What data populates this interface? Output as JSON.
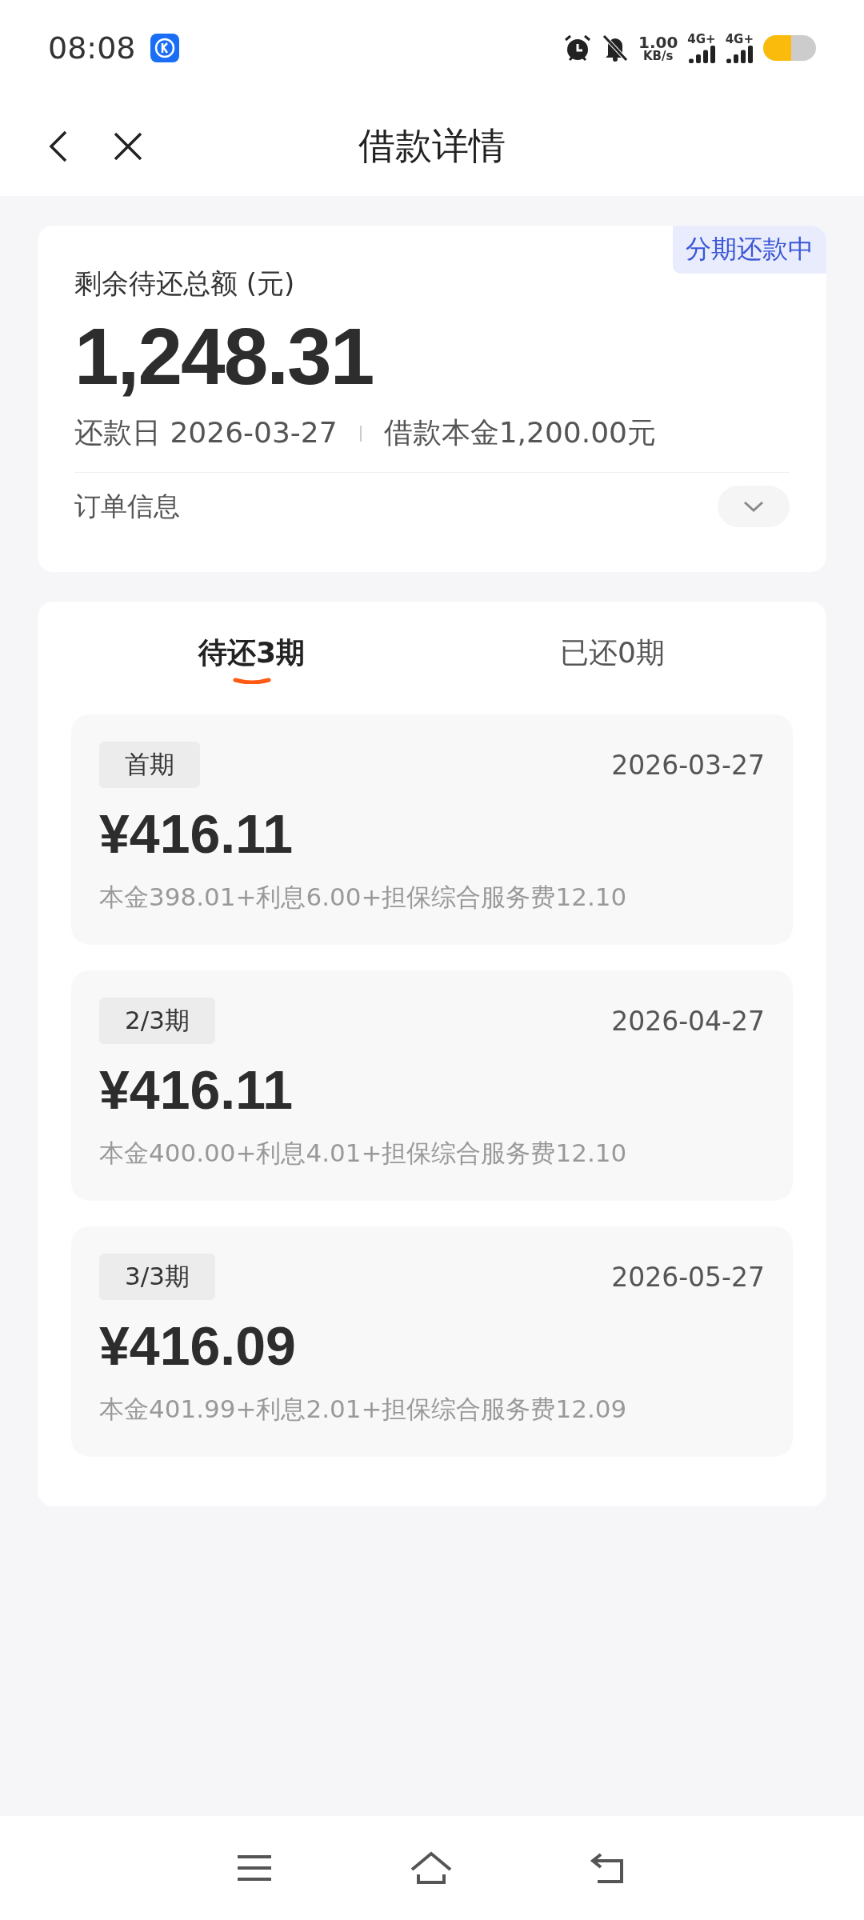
{
  "status_bar": {
    "time": "08:08",
    "speed_value": "1.00",
    "speed_unit": "KB/s",
    "networks": [
      "4G+",
      "4G+"
    ]
  },
  "header": {
    "title": "借款详情"
  },
  "summary": {
    "badge": "分期还款中",
    "label": "剩余待还总额 (元)",
    "amount": "1,248.31",
    "due_date": "还款日 2026-03-27",
    "principal": "借款本金1,200.00元",
    "order_info": "订单信息",
    "expanded": false
  },
  "tabs": [
    {
      "label": "待还3期",
      "selected": true
    },
    {
      "label": "已还0期",
      "selected": false
    }
  ],
  "installments": [
    {
      "period": "首期",
      "date": "2026-03-27",
      "amount": "¥416.11",
      "breakdown": "本金398.01+利息6.00+担保综合服务费12.10"
    },
    {
      "period": "2/3期",
      "date": "2026-04-27",
      "amount": "¥416.11",
      "breakdown": "本金400.00+利息4.01+担保综合服务费12.10"
    },
    {
      "period": "3/3期",
      "date": "2026-05-27",
      "amount": "¥416.09",
      "breakdown": "本金401.99+利息2.01+担保综合服务费12.09"
    }
  ]
}
